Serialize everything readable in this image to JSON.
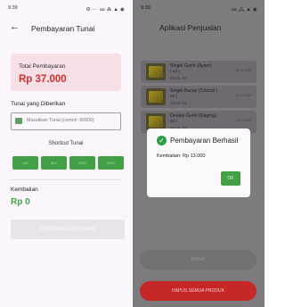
{
  "left": {
    "status": {
      "time": "9:39",
      "icons": "⚙ ··· ⅏ ⁂ ▲ ◉"
    },
    "header": {
      "back": "←",
      "title": "Pembayaran Tunai"
    },
    "total": {
      "label": "Total Pembayaran",
      "value": "Rp 37.000"
    },
    "given": {
      "label": "Tunai yang Diberikan",
      "placeholder": "Masukkan Tunai (contoh: 50000)"
    },
    "shortcut": {
      "title": "Shortcut Tunai",
      "chips": [
        "40K",
        "50K",
        "100K",
        "150K"
      ]
    },
    "change": {
      "label": "Kembalian",
      "value": "Rp 0"
    },
    "confirm_label": "Konfirmasi Pembayaran"
  },
  "right": {
    "status": {
      "time": "9:39",
      "icons": "⅏ ⁂ ▲ ◉"
    },
    "header": {
      "title": "Aplikasi Penjualan"
    },
    "products": [
      {
        "name": "Single Gurih (Ayam)",
        "qty": "( x3 )",
        "stock": "Stock: 69",
        "price": "Rp 12.000"
      },
      {
        "name": "Single Bucan (Chocol )",
        "qty": "x0 )",
        "stock": "Stock: 99",
        "price": "Rp 12.000"
      },
      {
        "name": "Double Gurih (Daging)",
        "qty": "x0 )",
        "stock": "Stock: 99",
        "price": "Rp 45.000"
      }
    ],
    "dialog": {
      "title": "Pembayaran Berhasil",
      "message": "Kembalian: Rp 13.000",
      "ok": "OK"
    },
    "bayar_label": "BAYAR",
    "hapus_label": "HAPUS SEMUA PRODUK"
  }
}
